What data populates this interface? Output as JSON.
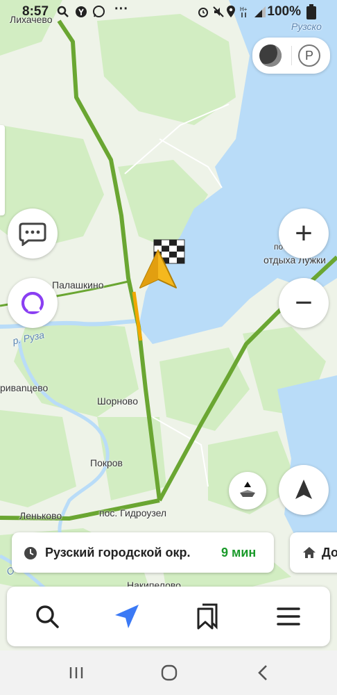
{
  "status_bar": {
    "time": "8:57",
    "battery": "100%"
  },
  "map_labels": {
    "likhachevo": "Лихачево",
    "ruzskoe": "Рузско",
    "palashkino": "Палашкино",
    "ruza_river": "р. Руза",
    "rivantsevo": "ривanцево",
    "shornovo": "Шорново",
    "pokrov": "Покров",
    "lenkovo": "Леньково",
    "gidrouzel": "пос. Гидроузел",
    "nakipelovo": "Накипелово",
    "luzhki_line1": "пос. дома",
    "luzhki_line2": "отдыха Лужки",
    "ozero": "Озер"
  },
  "route_card": {
    "name": "Рузский городской окр.",
    "time": "9 мин"
  },
  "route_card_secondary": {
    "name": "До"
  },
  "icons": {
    "parking": "P",
    "chat": "chat-bubble-icon",
    "alice": "alice-icon",
    "zoom_in": "+",
    "zoom_out": "−"
  },
  "colors": {
    "water": "#b9dcf8",
    "forest": "#d2edc2",
    "route": "#6aa632",
    "route_slow": "#f0a800",
    "accent": "#3b79f5",
    "alice": "#8a3ff2"
  }
}
